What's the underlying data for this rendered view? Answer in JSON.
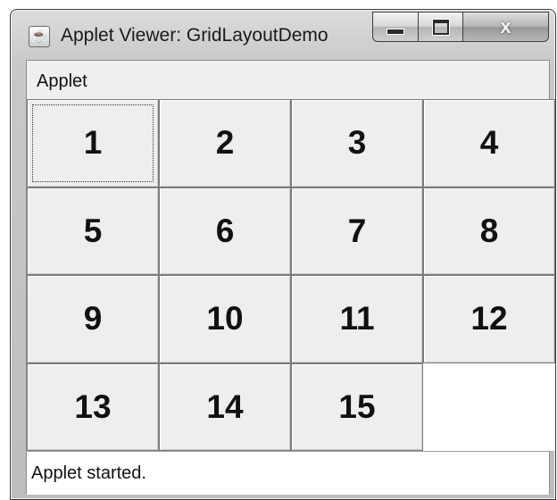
{
  "window": {
    "title": "Applet Viewer: GridLayoutDemo",
    "icon": "java-cup-icon",
    "controls": {
      "minimize": "minimize-icon",
      "maximize": "maximize-icon",
      "close": "x"
    }
  },
  "menubar": {
    "items": [
      {
        "label": "Applet"
      }
    ]
  },
  "grid": {
    "buttons": [
      {
        "label": "1",
        "focused": true
      },
      {
        "label": "2"
      },
      {
        "label": "3"
      },
      {
        "label": "4"
      },
      {
        "label": "5"
      },
      {
        "label": "6"
      },
      {
        "label": "7"
      },
      {
        "label": "8"
      },
      {
        "label": "9"
      },
      {
        "label": "10"
      },
      {
        "label": "11"
      },
      {
        "label": "12"
      },
      {
        "label": "13"
      },
      {
        "label": "14"
      },
      {
        "label": "15"
      }
    ]
  },
  "status": {
    "text": "Applet started."
  }
}
